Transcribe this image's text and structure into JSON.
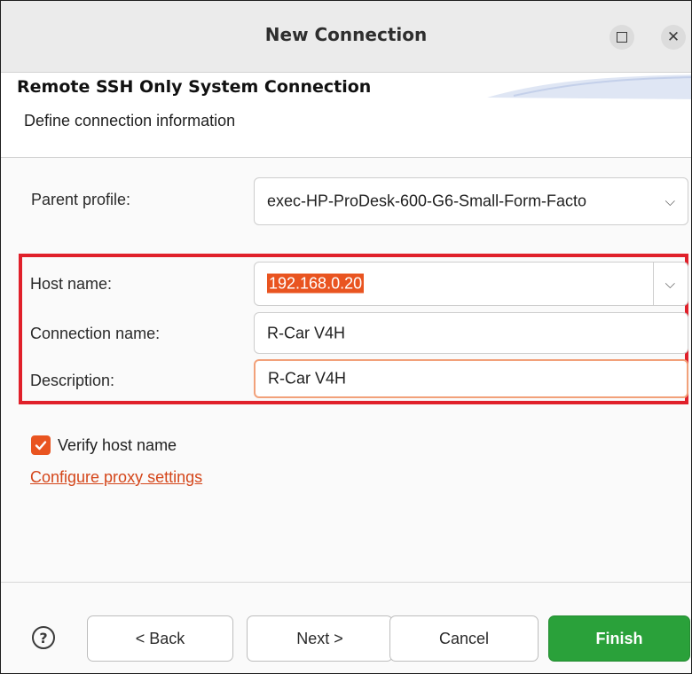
{
  "window": {
    "title": "New Connection"
  },
  "banner": {
    "title": "Remote SSH Only System Connection",
    "description": "Define connection information"
  },
  "form": {
    "parent_profile": {
      "label": "Parent profile:",
      "value": "exec-HP-ProDesk-600-G6-Small-Form-Facto"
    },
    "host_name": {
      "label": "Host name:",
      "value": "192.168.0.20"
    },
    "connection_name": {
      "label": "Connection name:",
      "value": "R-Car V4H"
    },
    "description": {
      "label": "Description:",
      "value": "R-Car V4H"
    },
    "verify_host_name": {
      "label": "Verify host name",
      "checked": true
    },
    "proxy_link": "Configure proxy settings"
  },
  "footer": {
    "help_icon": "help-icon",
    "back_label": "< Back",
    "next_label": "Next >",
    "cancel_label": "Cancel",
    "finish_label": "Finish"
  },
  "colors": {
    "accent": "#e95420",
    "highlight_border": "#e0202a",
    "finish_green": "#2aa13a"
  }
}
